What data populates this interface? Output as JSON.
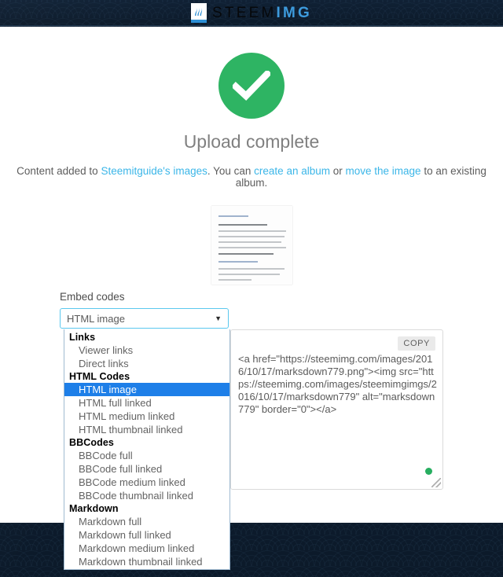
{
  "header": {
    "brand_primary": "STEEM",
    "brand_secondary": "IMG",
    "logo_icon": "steem-waves-logo"
  },
  "status": {
    "icon": "check-circle-icon",
    "headline": "Upload complete",
    "accent_color": "#2eb463"
  },
  "description": {
    "part1": "Content added to ",
    "album_link": "Steemitguide's images",
    "part2": ". You can ",
    "create_link": "create an album",
    "part3": " or ",
    "move_link": "move the image",
    "part4": " to an existing album.",
    "link_color": "#3bb6e8"
  },
  "preview": {
    "alt": "uploaded-image-thumbnail"
  },
  "embed": {
    "label": "Embed codes",
    "selected_value": "HTML image",
    "caret_icon": "chevron-down-icon",
    "copy_label": "COPY",
    "code_value": "<a href=\"https://steemimg.com/images/2016/10/17/marksdown779.png\"><img src=\"https://steemimg.com/images/steemimgimgs/2016/10/17/marksdown779\" alt=\"marksdown779\" border=\"0\"></a>",
    "groups": [
      {
        "label": "Links",
        "options": [
          "Viewer links",
          "Direct links"
        ]
      },
      {
        "label": "HTML Codes",
        "options": [
          "HTML image",
          "HTML full linked",
          "HTML medium linked",
          "HTML thumbnail linked"
        ]
      },
      {
        "label": "BBCodes",
        "options": [
          "BBCode full",
          "BBCode full linked",
          "BBCode medium linked",
          "BBCode thumbnail linked"
        ]
      },
      {
        "label": "Markdown",
        "options": [
          "Markdown full",
          "Markdown full linked",
          "Markdown medium linked",
          "Markdown thumbnail linked"
        ]
      }
    ],
    "highlight_color": "#1e7fe8"
  }
}
